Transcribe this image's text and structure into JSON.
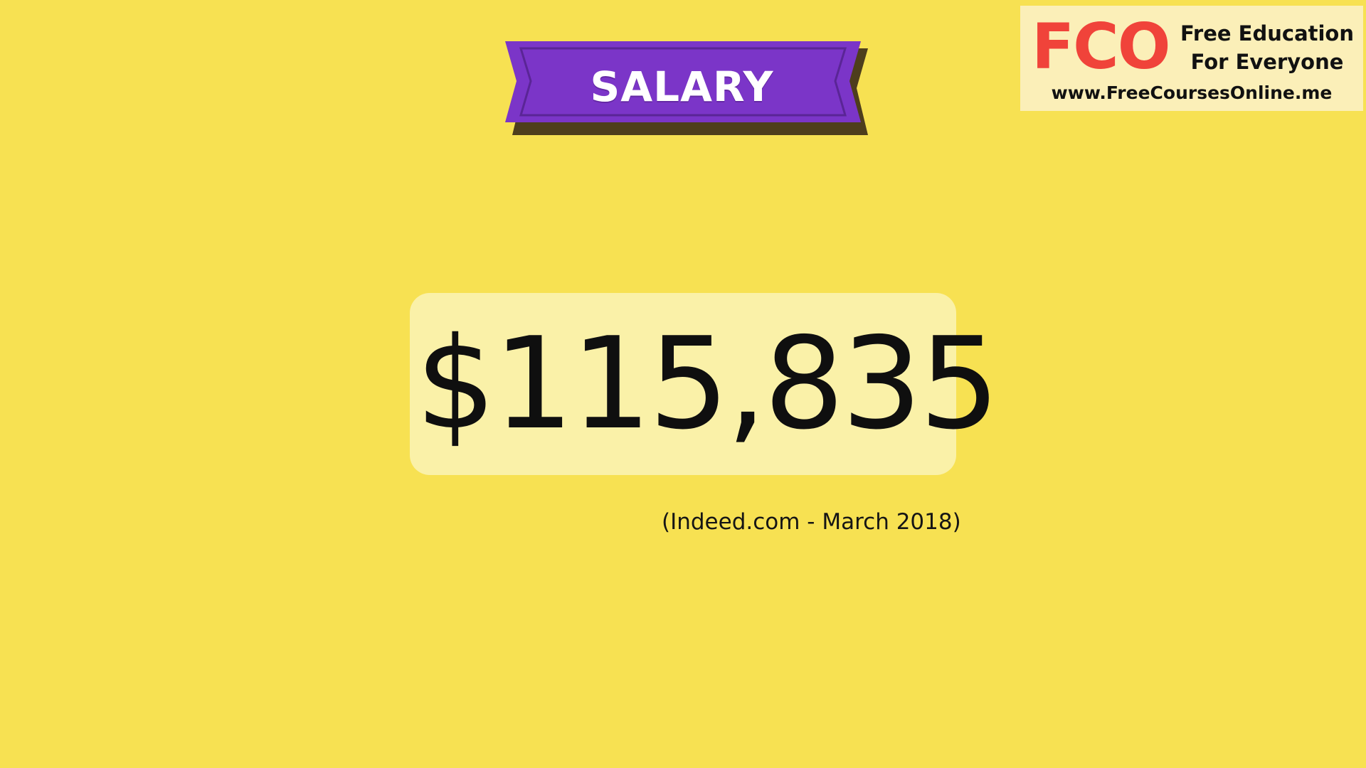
{
  "colors": {
    "background": "#F7E152",
    "ribbon_purple": "#7B35C8",
    "ribbon_dark": "#5A2596",
    "ribbon_shadow": "#4E3E1C",
    "value_box": "#FAF1A8",
    "logo_red": "#F0433A",
    "logo_bg": "#FBEFB8",
    "text_dark": "#0F0F0F"
  },
  "title": {
    "label": "SALARY"
  },
  "logo": {
    "mark": "FCO",
    "tagline_line1": "Free Education",
    "tagline_line2": "For Everyone",
    "url": "www.FreeCoursesOnline.me"
  },
  "salary": {
    "value": "$115,835",
    "source": "(Indeed.com - March 2018)"
  }
}
